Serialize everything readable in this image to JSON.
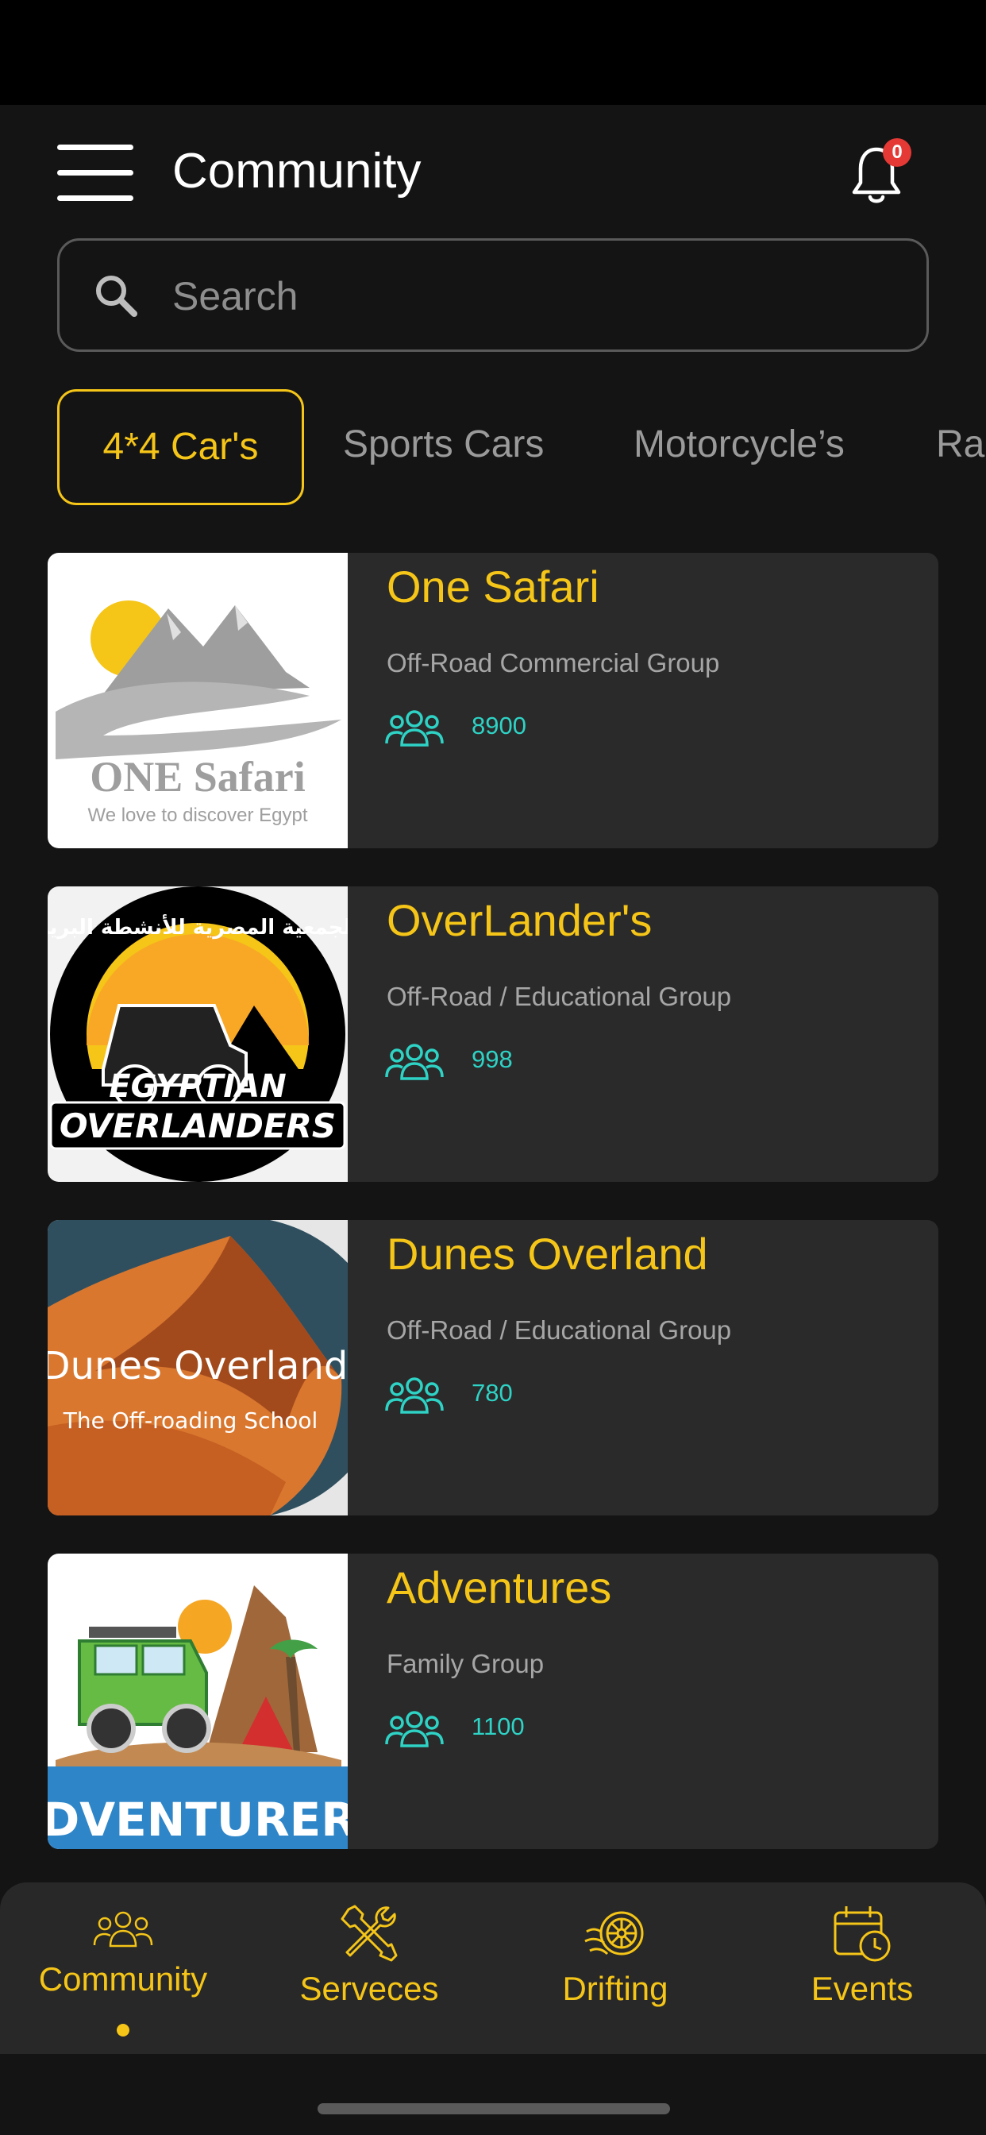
{
  "header": {
    "title": "Community",
    "notifications_count": "0"
  },
  "search": {
    "placeholder": "Search",
    "value": ""
  },
  "tabs": [
    {
      "label": "4*4 Car's",
      "active": true
    },
    {
      "label": "Sports Cars",
      "active": false
    },
    {
      "label": "Motorcycle’s",
      "active": false
    },
    {
      "label": "Ral",
      "active": false
    }
  ],
  "groups": [
    {
      "name": "One Safari",
      "category": "Off-Road Commercial Group",
      "members": "8900",
      "logo": {
        "brand": "ONE Safari",
        "tagline": "We love to discover Egypt"
      }
    },
    {
      "name": "OverLander's",
      "category": "Off-Road / Educational Group",
      "members": "998",
      "logo": {
        "arabic": "الجمعية المصرية للأنشطة البرية",
        "line1": "EGYPTIAN",
        "line2": "OVERLANDERS"
      }
    },
    {
      "name": "Dunes Overland",
      "category": "Off-Road / Educational Group",
      "members": "780",
      "logo": {
        "brand": "Dunes Overland",
        "tagline": "The Off-roading School"
      }
    },
    {
      "name": "Adventures",
      "category": "Family Group",
      "members": "1100",
      "logo": {
        "brand": "ADVENTURERS"
      }
    }
  ],
  "bottom_nav": [
    {
      "label": "Community",
      "icon": "people-icon",
      "active": true
    },
    {
      "label": "Serveces",
      "icon": "tools-icon",
      "active": false
    },
    {
      "label": "Drifting",
      "icon": "wheel-icon",
      "active": false
    },
    {
      "label": "Events",
      "icon": "calendar-clock-icon",
      "active": false
    }
  ],
  "colors": {
    "accent": "#f5c518",
    "members": "#2ed3c6",
    "background": "#141414",
    "card": "#2a2a2a",
    "badge": "#e53935"
  }
}
